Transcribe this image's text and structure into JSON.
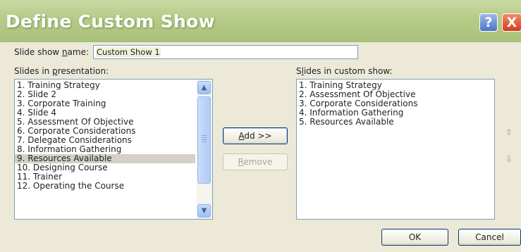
{
  "window": {
    "title": "Define Custom Show",
    "help_label": "?",
    "close_label": "X"
  },
  "show_name": {
    "label_prefix": "Slide show ",
    "label_accel": "n",
    "label_suffix": "ame:",
    "value": "Custom Show 1"
  },
  "left": {
    "label_prefix": "Slides in ",
    "label_accel": "p",
    "label_suffix": "resentation:",
    "items": [
      "1. Training Strategy",
      "2. Slide 2",
      "3. Corporate Training",
      "4. Slide 4",
      "5. Assessment Of Objective",
      "6. Corporate Considerations",
      "7. Delegate Considerations",
      "8. Information Gathering",
      "9. Resources Available",
      "10. Designing Course",
      "11. Trainer",
      "12. Operating the Course"
    ],
    "selected_index": 8
  },
  "right": {
    "label_prefix": "S",
    "label_accel": "l",
    "label_suffix": "ides in custom show:",
    "items": [
      "1. Training Strategy",
      "2. Assessment Of Objective",
      "3. Corporate Considerations",
      "4. Information Gathering",
      "5. Resources Available"
    ]
  },
  "buttons": {
    "add_accel": "A",
    "add_rest": "dd >>",
    "remove_accel": "R",
    "remove_rest": "emove",
    "ok": "OK",
    "cancel": "Cancel"
  },
  "icons": {
    "move_up": "up-arrow-icon",
    "move_down": "down-arrow-icon",
    "scroll_up": "scroll-up-icon",
    "scroll_down": "scroll-down-icon"
  }
}
